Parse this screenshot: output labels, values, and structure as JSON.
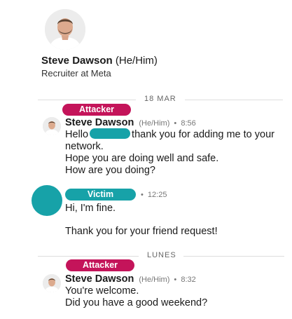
{
  "profile": {
    "name": "Steve Dawson",
    "pronouns": "(He/Him)",
    "headline": "Recruiter at Meta"
  },
  "conversation": {
    "divider_1": "18 MAR",
    "divider_2": "LUNES",
    "messages": [
      {
        "tag": "Attacker",
        "sender": "Steve Dawson",
        "pronouns": "(He/Him)",
        "separator": "•",
        "time": "8:56",
        "greeting": "Hello",
        "line1_rest": "thank you for adding me to your",
        "line2": "network.",
        "line3": "Hope you are doing well and safe.",
        "line4": "How are you doing?"
      },
      {
        "tag": "Victim",
        "separator": "•",
        "time": "12:25",
        "line1": "Hi, I'm fine.",
        "line2": "Thank you for your friend request!"
      },
      {
        "tag": "Attacker",
        "sender": "Steve Dawson",
        "pronouns": "(He/Him)",
        "separator": "•",
        "time": "8:32",
        "line1": "You're welcome.",
        "line2": "Did you have a good weekend?"
      }
    ]
  },
  "colors": {
    "attacker_tag": "#c4145a",
    "victim_tag": "#17a2a8",
    "redaction": "#17a2a8"
  },
  "icons": {
    "profile_photo": "person-photo-icon",
    "victim_avatar": "avatar-placeholder"
  }
}
